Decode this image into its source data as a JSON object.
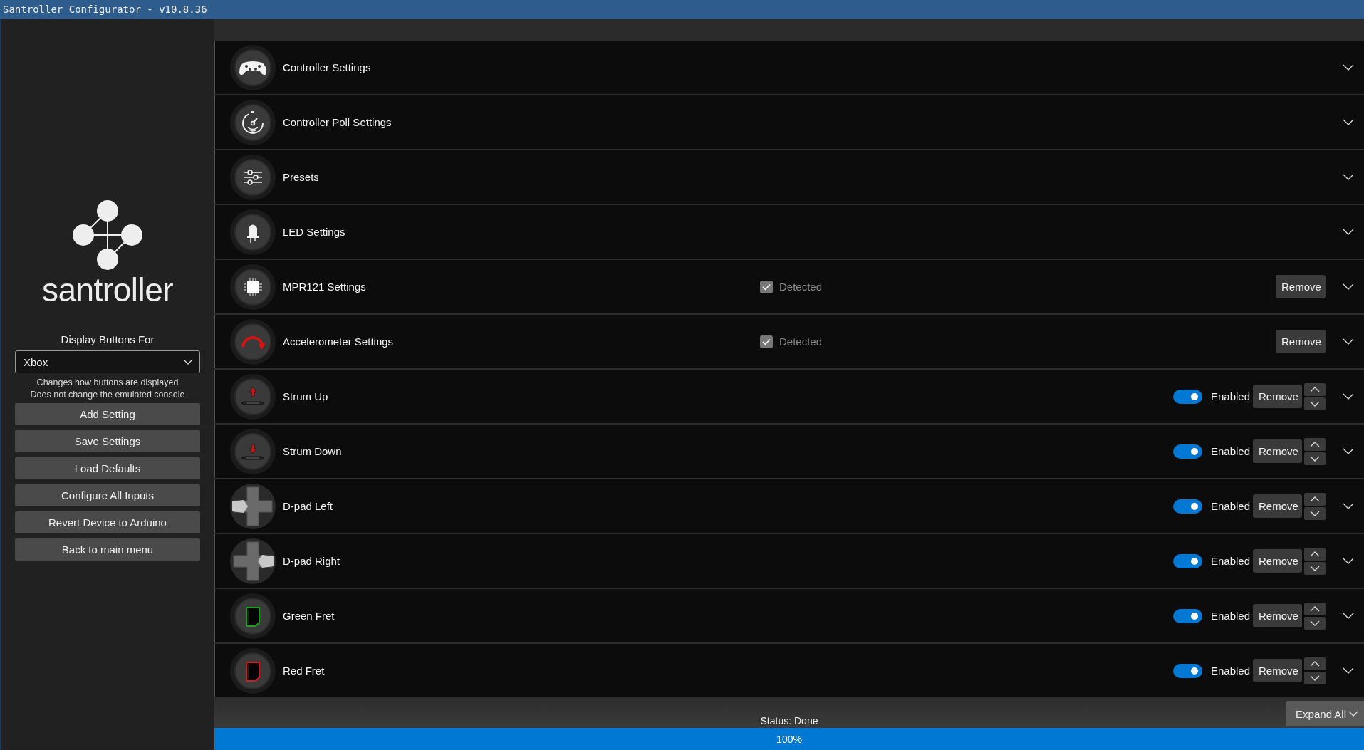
{
  "window": {
    "title": "Santroller Configurator - v10.8.36"
  },
  "sidebar": {
    "logo_text": "santroller",
    "display_label": "Display Buttons For",
    "display_select": {
      "value": "Xbox"
    },
    "notes": [
      "Changes how buttons are displayed",
      "Does not change the emulated console"
    ],
    "buttons": [
      "Add Setting",
      "Save Settings",
      "Load Defaults",
      "Configure All Inputs",
      "Revert Device to Arduino",
      "Back to main menu"
    ]
  },
  "settings": [
    {
      "title": "Controller Settings",
      "kind": "section",
      "expanded": false
    },
    {
      "title": "Controller Poll Settings",
      "kind": "section",
      "expanded": false
    },
    {
      "title": "Presets",
      "kind": "section",
      "expanded": false
    },
    {
      "title": "LED Settings",
      "kind": "section",
      "expanded": false
    },
    {
      "title": "MPR121 Settings",
      "kind": "detected",
      "expanded": false,
      "detected": {
        "label": "Detected",
        "checked": true,
        "disabled": true
      },
      "remove": "Remove"
    },
    {
      "title": "Accelerometer Settings",
      "kind": "detected",
      "expanded": false,
      "detected": {
        "label": "Detected",
        "checked": true,
        "disabled": true
      },
      "remove": "Remove"
    },
    {
      "title": "Strum Up",
      "kind": "input",
      "expanded": false,
      "enabled": {
        "label": "Enabled",
        "on": true
      },
      "remove": "Remove"
    },
    {
      "title": "Strum Down",
      "kind": "input",
      "expanded": false,
      "enabled": {
        "label": "Enabled",
        "on": true
      },
      "remove": "Remove"
    },
    {
      "title": "D-pad Left",
      "kind": "input",
      "expanded": false,
      "enabled": {
        "label": "Enabled",
        "on": true
      },
      "remove": "Remove"
    },
    {
      "title": "D-pad Right",
      "kind": "input",
      "expanded": false,
      "enabled": {
        "label": "Enabled",
        "on": true
      },
      "remove": "Remove"
    },
    {
      "title": "Green Fret",
      "color": "#1e9e1e",
      "kind": "input",
      "expanded": false,
      "enabled": {
        "label": "Enabled",
        "on": true
      },
      "remove": "Remove"
    },
    {
      "title": "Red Fret",
      "color": "#c81e1e",
      "kind": "input",
      "expanded": false,
      "enabled": {
        "label": "Enabled",
        "on": true
      },
      "remove": "Remove"
    }
  ],
  "status": "Status: Done",
  "expand_all": "Expand All",
  "progress": {
    "level": 1,
    "label": "100%"
  }
}
